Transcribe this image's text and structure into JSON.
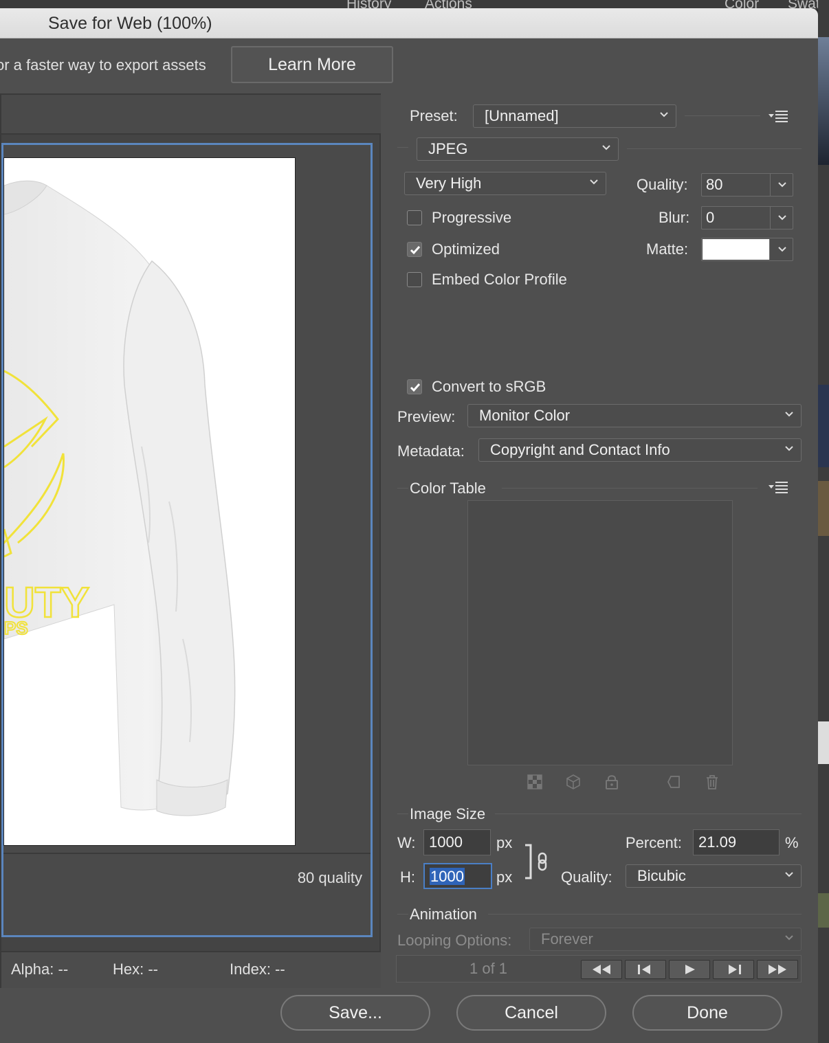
{
  "background": {
    "tabs": [
      "History",
      "Actions",
      "Color",
      "Swatc"
    ]
  },
  "dialog": {
    "title": "Save for Web (100%)",
    "promo_text": "or a faster way to export assets",
    "learn_more": "Learn More"
  },
  "preview": {
    "quality_annotation": "80 quality",
    "shirt_text_line1": "UTY",
    "shirt_text_line2": "PS",
    "status": {
      "alpha": "Alpha: --",
      "hex": "Hex: --",
      "index": "Index: --"
    }
  },
  "settings": {
    "preset_label": "Preset:",
    "preset_value": "[Unnamed]",
    "format_value": "JPEG",
    "compression_value": "Very High",
    "quality_label": "Quality:",
    "quality_value": "80",
    "blur_label": "Blur:",
    "blur_value": "0",
    "matte_label": "Matte:",
    "matte_color": "#ffffff",
    "progressive_label": "Progressive",
    "progressive_checked": false,
    "optimized_label": "Optimized",
    "optimized_checked": true,
    "embed_label": "Embed Color Profile",
    "embed_checked": false,
    "convert_label": "Convert to sRGB",
    "convert_checked": true,
    "preview_label": "Preview:",
    "preview_value": "Monitor Color",
    "metadata_label": "Metadata:",
    "metadata_value": "Copyright and Contact Info",
    "color_table_label": "Color Table",
    "image_size_label": "Image Size",
    "w_label": "W:",
    "w_value": "1000",
    "h_label": "H:",
    "h_value": "1000",
    "px_unit": "px",
    "percent_label": "Percent:",
    "percent_value": "21.09",
    "percent_unit": "%",
    "resample_label": "Quality:",
    "resample_value": "Bicubic",
    "animation_label": "Animation",
    "looping_label": "Looping Options:",
    "looping_value": "Forever",
    "frame_counter": "1 of 1"
  },
  "buttons": {
    "save": "Save...",
    "cancel": "Cancel",
    "done": "Done"
  },
  "colors": {
    "accent": "#5b86be",
    "focus": "#4a7fc6",
    "artwork_yellow": "#f1e23a"
  }
}
